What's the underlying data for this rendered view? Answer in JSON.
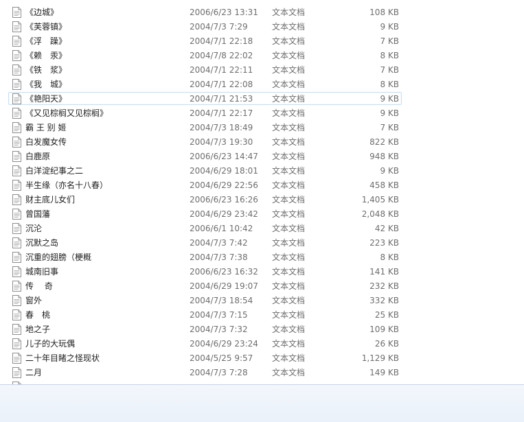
{
  "files": [
    {
      "name": "《边城》",
      "date": "2006/6/23 13:31",
      "type": "文本文档",
      "size": "108 KB"
    },
    {
      "name": "《芙蓉镇》",
      "date": "2004/7/3 7:29",
      "type": "文本文档",
      "size": "9 KB"
    },
    {
      "name": "《浮　躁》",
      "date": "2004/7/1 22:18",
      "type": "文本文档",
      "size": "7 KB"
    },
    {
      "name": "《赖　汞》",
      "date": "2004/7/8 22:02",
      "type": "文本文档",
      "size": "8 KB"
    },
    {
      "name": "《铁　浆》",
      "date": "2004/7/1 22:11",
      "type": "文本文档",
      "size": "7 KB"
    },
    {
      "name": "《我　城》",
      "date": "2004/7/1 22:08",
      "type": "文本文档",
      "size": "8 KB"
    },
    {
      "name": "《艳阳天》",
      "date": "2004/7/1 21:53",
      "type": "文本文档",
      "size": "9 KB"
    },
    {
      "name": "《又见棕榈又见棕榈》",
      "date": "2004/7/1 22:17",
      "type": "文本文档",
      "size": "9 KB"
    },
    {
      "name": "霸 王 别 姬",
      "date": "2004/7/3 18:49",
      "type": "文本文档",
      "size": "7 KB"
    },
    {
      "name": "白发魔女传",
      "date": "2004/7/3 19:30",
      "type": "文本文档",
      "size": "822 KB"
    },
    {
      "name": "白鹿原",
      "date": "2006/6/23 14:47",
      "type": "文本文档",
      "size": "948 KB"
    },
    {
      "name": "白洋淀纪事之二",
      "date": "2004/6/29 18:01",
      "type": "文本文档",
      "size": "9 KB"
    },
    {
      "name": "半生缘（亦名十八春）",
      "date": "2004/6/29 22:56",
      "type": "文本文档",
      "size": "458 KB"
    },
    {
      "name": "财主底儿女们",
      "date": "2006/6/23 16:26",
      "type": "文本文档",
      "size": "1,405 KB"
    },
    {
      "name": "曾国藩",
      "date": "2004/6/29 23:42",
      "type": "文本文档",
      "size": "2,048 KB"
    },
    {
      "name": "沉沦",
      "date": "2006/6/1 10:42",
      "type": "文本文档",
      "size": "42 KB"
    },
    {
      "name": "沉默之岛",
      "date": "2004/7/3 7:42",
      "type": "文本文档",
      "size": "223 KB"
    },
    {
      "name": "沉重的翅膀（梗概",
      "date": "2004/7/3 7:38",
      "type": "文本文档",
      "size": "8 KB"
    },
    {
      "name": "城南旧事",
      "date": "2006/6/23 16:32",
      "type": "文本文档",
      "size": "141 KB"
    },
    {
      "name": "传　 奇",
      "date": "2004/6/29 19:07",
      "type": "文本文档",
      "size": "232 KB"
    },
    {
      "name": "窗外",
      "date": "2004/7/3 18:54",
      "type": "文本文档",
      "size": "332 KB"
    },
    {
      "name": "春　桃",
      "date": "2004/7/3 7:15",
      "type": "文本文档",
      "size": "25 KB"
    },
    {
      "name": "地之子",
      "date": "2004/7/3 7:32",
      "type": "文本文档",
      "size": "109 KB"
    },
    {
      "name": "儿子的大玩偶",
      "date": "2004/6/29 23:24",
      "type": "文本文档",
      "size": "26 KB"
    },
    {
      "name": "二十年目睹之怪现状",
      "date": "2004/5/25 9:57",
      "type": "文本文档",
      "size": "1,129 KB"
    },
    {
      "name": "二月",
      "date": "2004/7/3 7:28",
      "type": "文本文档",
      "size": "149 KB"
    },
    {
      "name": "",
      "date": "",
      "type": "",
      "size": ""
    }
  ],
  "hovered_row": 6,
  "icon": "text-document-icon"
}
